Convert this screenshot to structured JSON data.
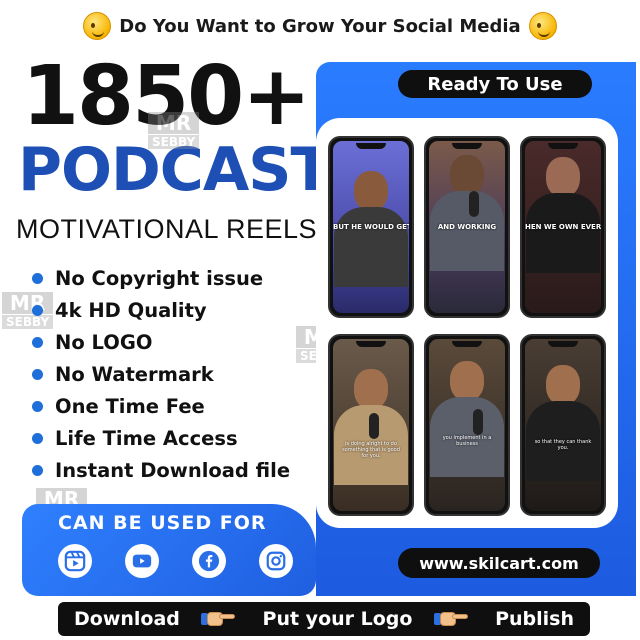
{
  "banner": {
    "text": "Do You Want to Grow Your Social Media"
  },
  "hero": {
    "count": "1850+",
    "title": "PODCAST",
    "subtitle": "MOTIVATIONAL REELS"
  },
  "features": [
    "No Copyright issue",
    "4k HD Quality",
    "No LOGO",
    "No Watermark",
    "One Time Fee",
    "Life Time Access",
    "Instant Download file"
  ],
  "watermark": {
    "top": "MR",
    "bottom": "SEBBY"
  },
  "used_for": {
    "title": "CAN BE USED FOR",
    "platforms": [
      "reels-icon",
      "youtube-icon",
      "facebook-icon",
      "instagram-icon"
    ]
  },
  "ready_label": "Ready To Use",
  "phones": [
    {
      "caption": "BUT HE WOULD GET UP AT"
    },
    {
      "caption": "AND WORKING"
    },
    {
      "caption": "HEN WE OWN EVERY HOUS"
    },
    {
      "caption": "is doing alright to do something that is good for you."
    },
    {
      "caption": "you implement in a business"
    },
    {
      "caption": "so that they can thank you."
    }
  ],
  "website": "www.skilcart.com",
  "steps": [
    "Download",
    "Put your Logo",
    "Publish"
  ],
  "colors": {
    "brand_blue": "#1d4fb5",
    "accent_blue": "#2a7cff",
    "bullet": "#1e6fd9",
    "dark": "#0f0f0f"
  }
}
